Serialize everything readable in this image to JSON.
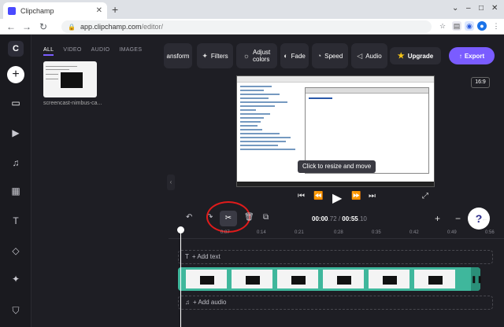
{
  "browser": {
    "tab_title": "Clipchamp",
    "tab_close": "✕",
    "new_tab": "+",
    "url_host": "app.clipchamp.com",
    "url_path": "/editor/",
    "min": "–",
    "max": "□",
    "close": "✕"
  },
  "rail": {
    "logo": "C",
    "add": "+"
  },
  "media": {
    "tabs": [
      "ALL",
      "VIDEO",
      "AUDIO",
      "IMAGES"
    ],
    "file_caption": "screencast-nimbus-ca..."
  },
  "toolbar": {
    "transform": "ansform",
    "filters": "Filters",
    "adjust_colors_1": "Adjust",
    "adjust_colors_2": "colors",
    "fade": "Fade",
    "speed": "Speed",
    "audio": "Audio",
    "upgrade": "Upgrade",
    "export": "Export"
  },
  "preview": {
    "tooltip": "Click to resize and move",
    "aspect_ratio": "16:9"
  },
  "timeline": {
    "current_time": "00:00",
    "current_frac": ".72",
    "total_time": "00:55",
    "total_frac": ".10",
    "separator": " / ",
    "ticks": [
      "0:07",
      "0:14",
      "0:21",
      "0:28",
      "0:35",
      "0:42",
      "0:49",
      "0:56"
    ],
    "add_text": "+ Add text",
    "add_audio": "+ Add audio"
  },
  "help": "?"
}
